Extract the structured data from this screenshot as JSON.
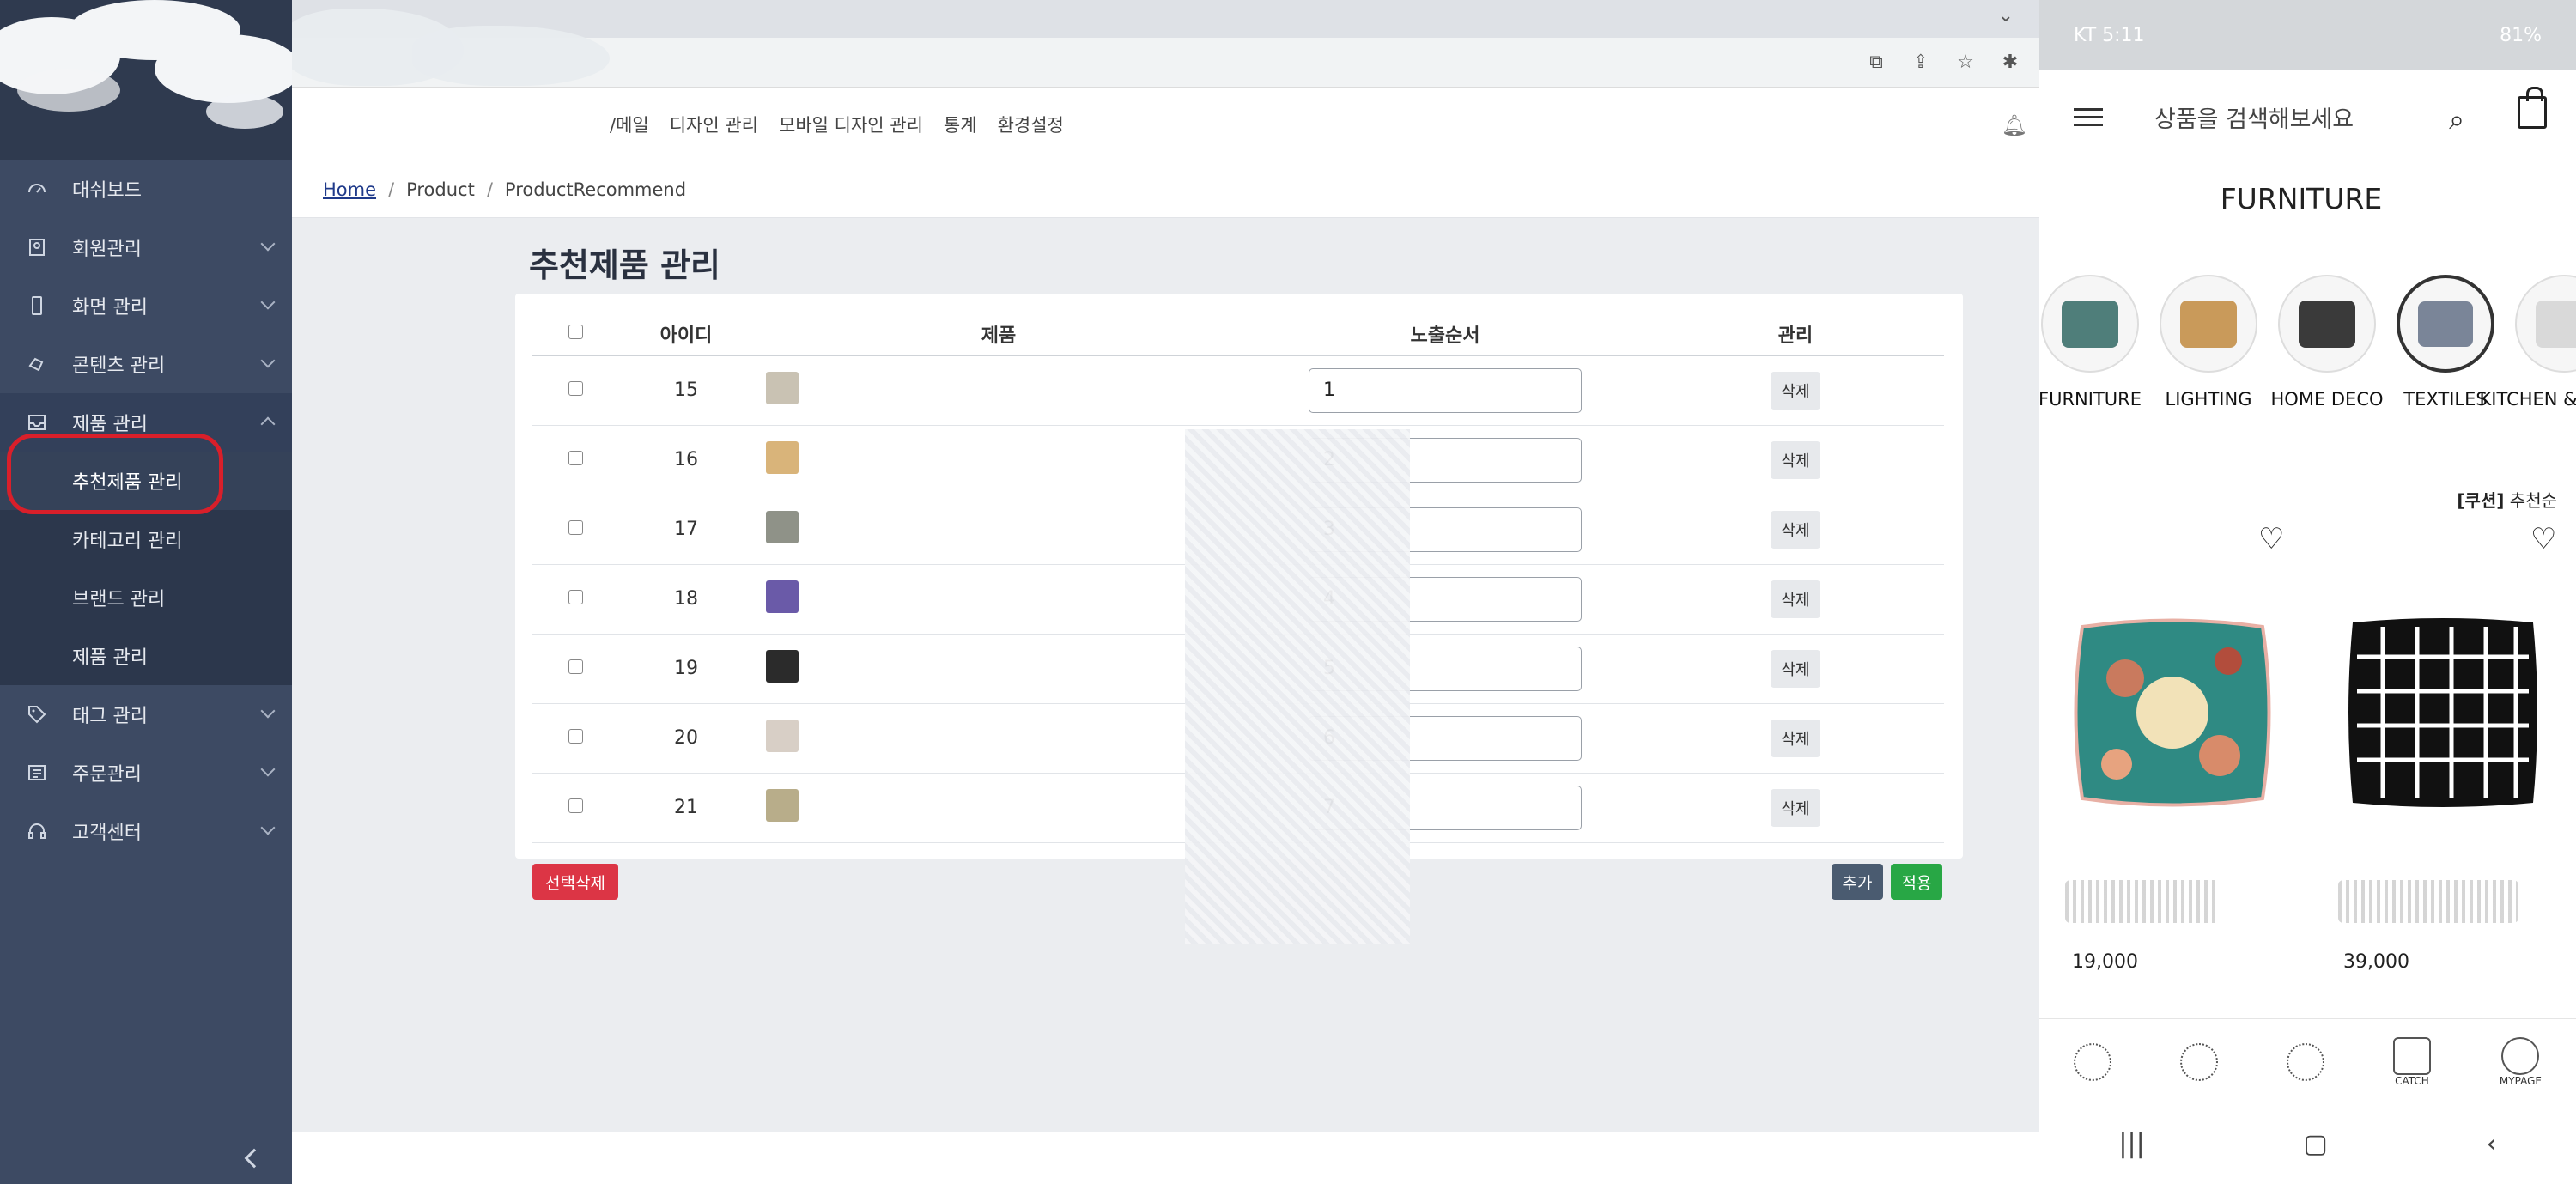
{
  "sidebar": {
    "items": [
      {
        "label": "대쉬보드",
        "icon": "dashboard-icon",
        "has_chevron": false
      },
      {
        "label": "회원관리",
        "icon": "member-icon",
        "has_chevron": true
      },
      {
        "label": "화면 관리",
        "icon": "mobile-icon",
        "has_chevron": true
      },
      {
        "label": "콘텐츠 관리",
        "icon": "hand-icon",
        "has_chevron": true
      },
      {
        "label": "제품 관리",
        "icon": "inbox-icon",
        "has_chevron": true,
        "expanded": true
      },
      {
        "label": "태그 관리",
        "icon": "tag-icon",
        "has_chevron": true
      },
      {
        "label": "주문관리",
        "icon": "order-list-icon",
        "has_chevron": true
      },
      {
        "label": "고객센터",
        "icon": "headset-icon",
        "has_chevron": true
      }
    ],
    "submenu": [
      {
        "label": "추천제품 관리",
        "active": true
      },
      {
        "label": "카테고리 관리"
      },
      {
        "label": "브랜드 관리"
      },
      {
        "label": "제품 관리"
      }
    ],
    "highlight_color": "#d91f2a"
  },
  "topnav": {
    "links": [
      "/메일",
      "디자인 관리",
      "모바일 디자인 관리",
      "통계",
      "환경설정"
    ]
  },
  "breadcrumb": {
    "home": "Home",
    "level1": "Product",
    "level2": "ProductRecommend"
  },
  "page": {
    "title": "추천제품 관리"
  },
  "table": {
    "headers": {
      "id": "아이디",
      "product": "제품",
      "order": "노출순서",
      "manage": "관리"
    },
    "rows": [
      {
        "id": "15",
        "order": "1",
        "thumb": "#c9c2b3"
      },
      {
        "id": "16",
        "order": "2",
        "thumb": "#d9b47a"
      },
      {
        "id": "17",
        "order": "3",
        "thumb": "#8f9288"
      },
      {
        "id": "18",
        "order": "4",
        "thumb": "#6a5aa8"
      },
      {
        "id": "19",
        "order": "5",
        "thumb": "#2b2b2b"
      },
      {
        "id": "20",
        "order": "6",
        "thumb": "#d8cfc6"
      },
      {
        "id": "21",
        "order": "7",
        "thumb": "#b8ad8a"
      }
    ],
    "delete_label": "삭제"
  },
  "buttons": {
    "bulk_delete": "선택삭제",
    "add": "추가",
    "apply": "적용"
  },
  "phone": {
    "status_left": "KT 5:11",
    "status_right": "81%",
    "search_placeholder": "상품을 검색해보세요",
    "category_title": "FURNITURE",
    "categories": [
      {
        "label": "FURNITURE",
        "color": "#4f7e7a"
      },
      {
        "label": "LIGHTING",
        "color": "#c99a5a"
      },
      {
        "label": "HOME DECO",
        "color": "#3a3a3a"
      },
      {
        "label": "TEXTILES",
        "color": "#7a8598",
        "selected": true
      },
      {
        "label": "KITCHEN & DINING",
        "color": "#d9d9d9"
      }
    ],
    "sort_label_bold": "[쿠션]",
    "sort_label": "추천순",
    "products": [
      {
        "price": "19,000"
      },
      {
        "price": "39,000"
      }
    ],
    "bottom_nav": [
      "",
      "",
      "",
      "CATCH",
      "MYPAGE"
    ]
  }
}
